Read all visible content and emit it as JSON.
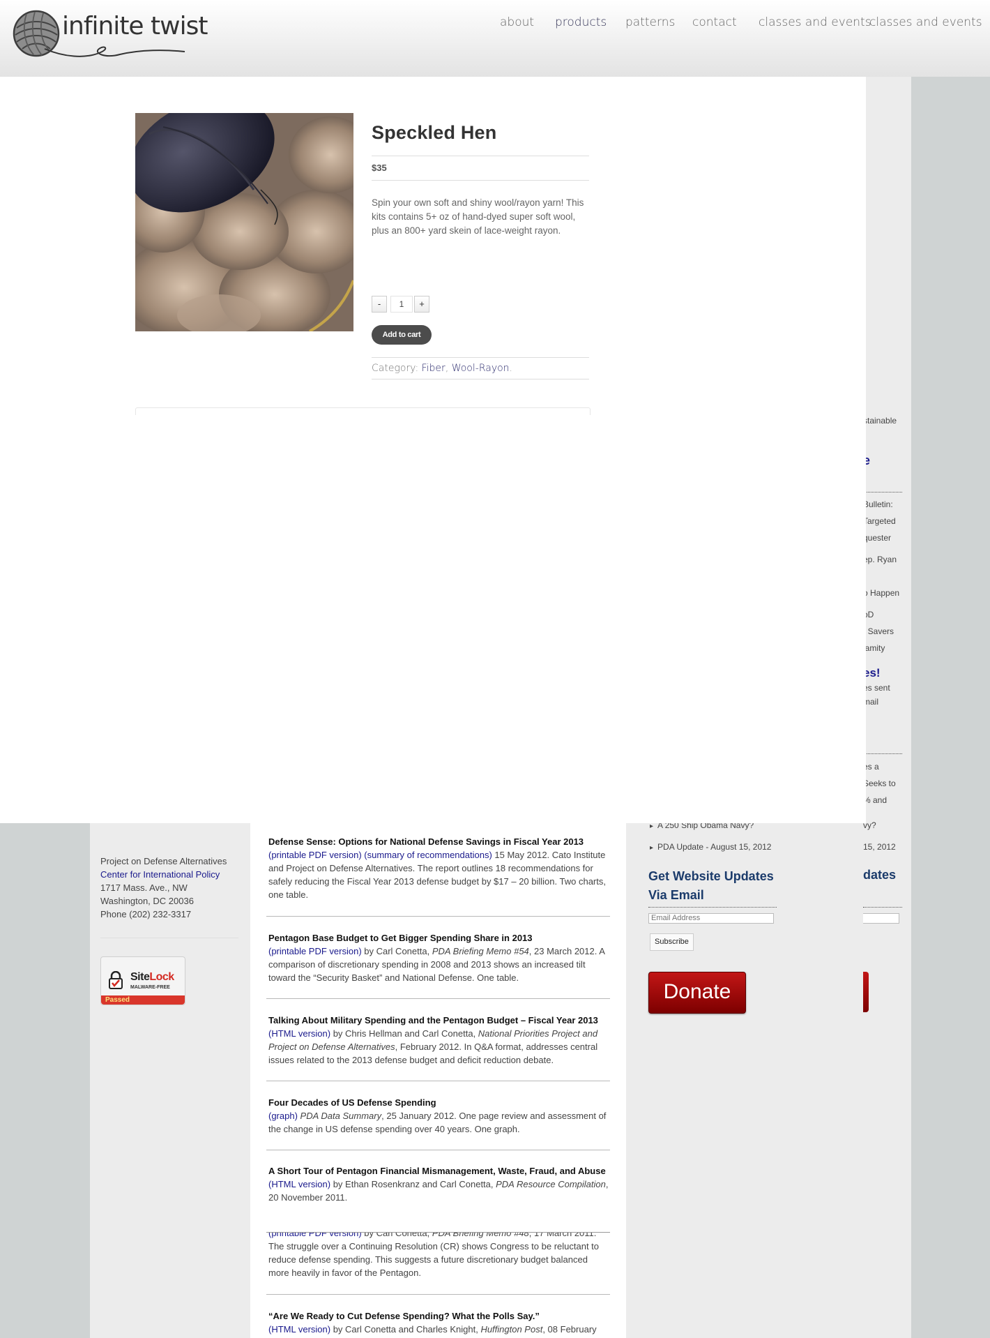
{
  "header": {
    "logo_text": "infinite twist",
    "nav": [
      {
        "label": "about"
      },
      {
        "label": "products"
      },
      {
        "label": "patterns"
      },
      {
        "label": "contact"
      },
      {
        "label": "classes and events"
      },
      {
        "label": "classes and events"
      }
    ]
  },
  "product": {
    "title": "Speckled Hen",
    "price": "$35",
    "description": "Spin your own soft and shiny wool/rayon yarn! This kits contains 5+ oz of hand-dyed super soft wool, plus an 800+ yard skein of lace-weight rayon.",
    "quantity": "1",
    "minus_label": "-",
    "plus_label": "+",
    "add_to_cart_label": "Add to cart",
    "category_label": "Category:",
    "categories": [
      "Fiber",
      "Wool-Rayon"
    ],
    "category_sep": ",",
    "category_end": "."
  },
  "pda": {
    "contact": {
      "org": "Project on Defense Alternatives",
      "center": "Center for International Policy",
      "address1": "1717 Mass. Ave., NW",
      "address2": "Washington, DC 20036",
      "phone": "Phone (202) 232-3317"
    },
    "sitelock": {
      "brand_a": "Site",
      "brand_b": "Lock",
      "sub": "MALWARE-FREE",
      "status": "Passed"
    },
    "articles": [
      {
        "title": "Defense Sense: Options for National Defense Savings in Fiscal Year 2013",
        "links": [
          "(printable PDF version)",
          "(summary of recommendations)"
        ],
        "body": " 15 May 2012. Cato Institute and Project on Defense Alternatives. The report outlines 18 recommendations for safely reducing the Fiscal Year 2013 defense budget by $17 – 20 billion. Two charts, one table."
      },
      {
        "title": "Pentagon Base Budget to Get Bigger Spending Share in 2013",
        "links": [
          "(printable PDF version)"
        ],
        "pre": " by Carl Conetta, ",
        "italic": "PDA Briefing Memo #54",
        "body": ", 23 March 2012. A comparison of discretionary spending in 2008 and 2013 shows an increased tilt toward the “Security Basket” and National Defense. One table."
      },
      {
        "title": "Talking About Military Spending and the Pentagon Budget – Fiscal Year 2013",
        "links": [
          "(HTML version)"
        ],
        "pre": " by Chris Hellman and Carl Conetta, ",
        "italic": "National Priorities Project and Project on Defense Alternatives",
        "body": ", February 2012. In Q&A format, addresses central issues related to the 2013 defense budget and deficit reduction debate."
      },
      {
        "title": "Four Decades of US Defense Spending",
        "links": [
          "(graph)"
        ],
        "pre": " ",
        "italic": "PDA Data Summary",
        "body": ", 25 January 2012. One page review and assessment of the change in US defense spending over 40 years. One graph."
      },
      {
        "title": "A Short Tour of Pentagon Financial Mismanagement, Waste, Fraud, and Abuse",
        "links": [
          "(HTML version)"
        ],
        "pre": " by Ethan Rosenkranz and Carl Conetta, ",
        "italic": "PDA Resource Compilation",
        "body": ", 20 November 2011."
      },
      {
        "title": "",
        "links": [
          "(printable PDF version)"
        ],
        "pre": " by Carl Conetta, ",
        "italic": "PDA Briefing Memo #48",
        "body": ", 17 March 2011. The struggle over a Continuing Resolution (CR) shows Congress to be reluctant to reduce defense spending. This suggests a future discretionary budget balanced more heavily in favor of the Pentagon."
      },
      {
        "title": "“Are We Ready to Cut Defense Spending? What the Polls Say.”",
        "links": [
          "(HTML version)"
        ],
        "pre": " by Carl Conetta and Charles Knight, ",
        "italic": "Huffington Post",
        "body": ", 08 February"
      }
    ],
    "sidebar": {
      "items": [
        "A 250 Ship Obama Navy?",
        "PDA Update - August 15, 2012"
      ],
      "updates_heading": "Get Website Updates Via Email",
      "email_placeholder": "Email Address",
      "subscribe_label": "Subscribe",
      "donate_label": "Donate"
    },
    "ghost": {
      "lines": [
        "stainable",
        "Bulletin:",
        "Targeted",
        "quester",
        "ep. Ryan",
        "o Happen",
        "oD",
        "t Savers",
        "lamity",
        "es sent",
        "mail",
        "es a",
        "Seeks to",
        "% and",
        "vy?",
        "15, 2012"
      ],
      "head_e": "e",
      "head_es": "es!",
      "head_dates": "dates"
    }
  }
}
